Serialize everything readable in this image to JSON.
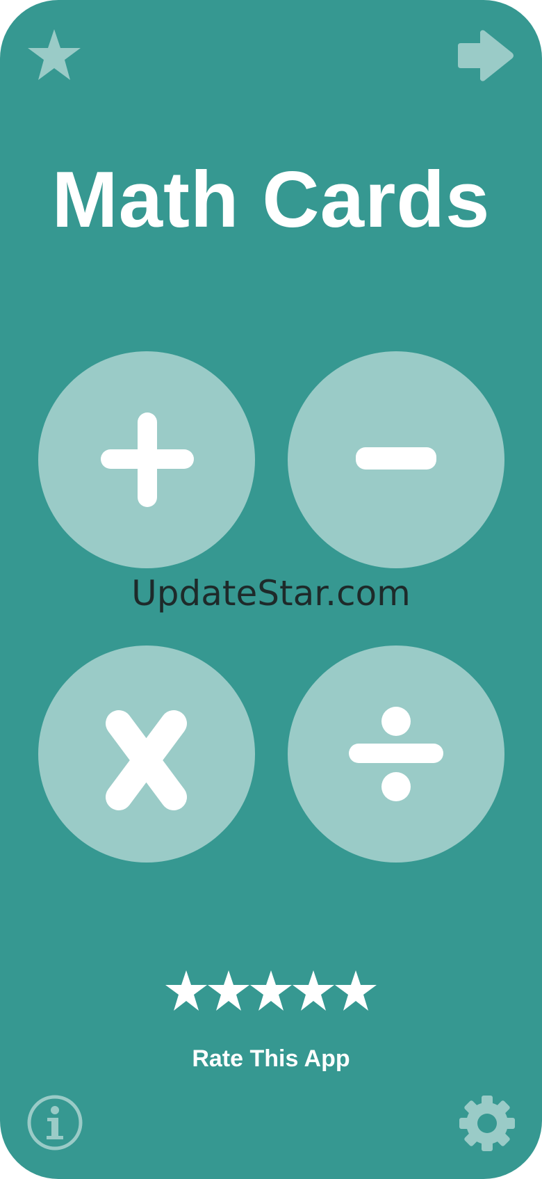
{
  "app": {
    "title": "Math Cards"
  },
  "top_bar": {
    "left_icon": "star-icon",
    "right_icon": "arrow-right-icon"
  },
  "operations": [
    {
      "name": "addition",
      "icon": "plus-icon"
    },
    {
      "name": "subtraction",
      "icon": "minus-icon"
    },
    {
      "name": "multiplication",
      "icon": "multiply-icon"
    },
    {
      "name": "division",
      "icon": "divide-icon"
    }
  ],
  "watermark": "UpdateStar.com",
  "rating": {
    "stars": 5,
    "label": "Rate This App"
  },
  "bottom_bar": {
    "left_icon": "info-icon",
    "right_icon": "gear-icon"
  },
  "colors": {
    "background": "#369891",
    "button": "#9acbc7",
    "icon_light": "#9acbc7",
    "text": "#ffffff"
  }
}
